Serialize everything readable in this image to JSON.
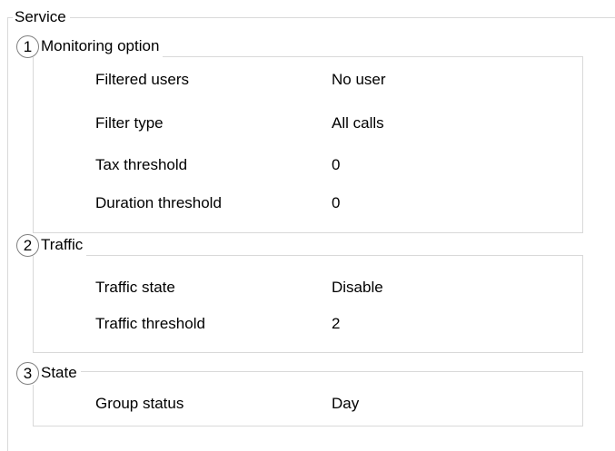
{
  "service": {
    "title": "Service",
    "sections": [
      {
        "number": "1",
        "title": "Monitoring option",
        "rows": [
          {
            "label": "Filtered users",
            "value": "No user"
          },
          {
            "label": "Filter type",
            "value": "All calls"
          },
          {
            "label": "Tax threshold",
            "value": "0"
          },
          {
            "label": "Duration threshold",
            "value": "0"
          }
        ]
      },
      {
        "number": "2",
        "title": "Traffic",
        "rows": [
          {
            "label": "Traffic state",
            "value": "Disable"
          },
          {
            "label": "Traffic threshold",
            "value": "2"
          }
        ]
      },
      {
        "number": "3",
        "title": "State",
        "rows": [
          {
            "label": "Group status",
            "value": "Day"
          }
        ]
      }
    ]
  }
}
